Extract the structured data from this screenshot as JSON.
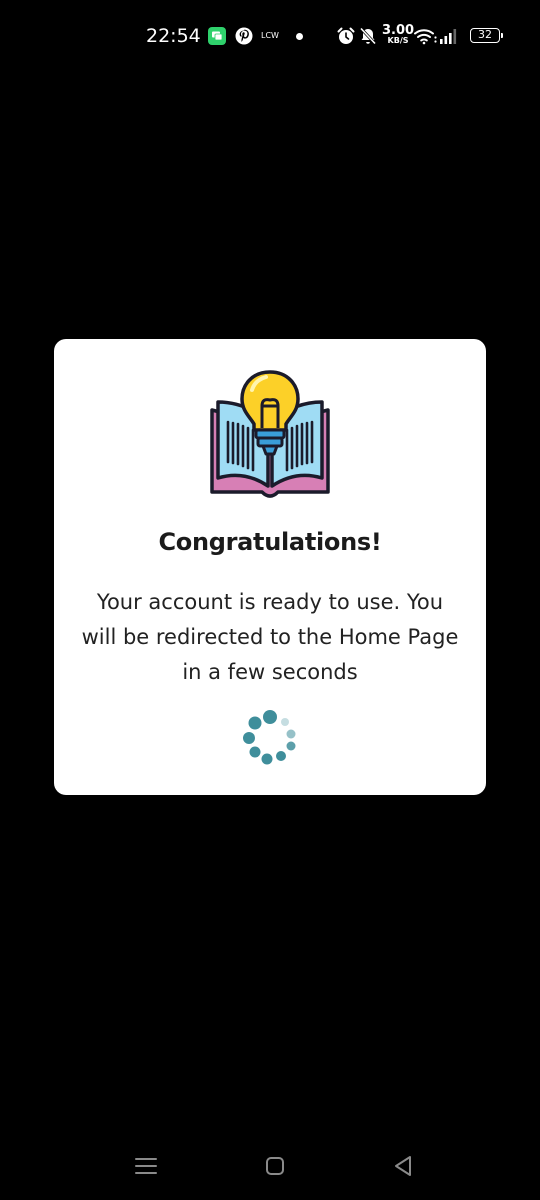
{
  "status_bar": {
    "time": "22:54",
    "lcw_label": "LCW",
    "net_speed_value": "3.00",
    "net_speed_unit": "KB/S",
    "battery_level": "32",
    "icons": [
      "chat-icon",
      "pinterest-icon",
      "dot-icon",
      "alarm-icon",
      "mute-icon",
      "wifi-icon",
      "signal-icon",
      "battery-icon"
    ]
  },
  "dialog": {
    "illustration_icon": "book-lightbulb-icon",
    "title": "Congratulations!",
    "message": "Your account is ready to use. You will be redirected to the Home Page in a few seconds",
    "spinner_icon": "loading-spinner-icon",
    "spinner_color": "#3f8e9b"
  },
  "nav_bar": {
    "icons": [
      "menu-icon",
      "home-icon",
      "back-icon"
    ]
  }
}
